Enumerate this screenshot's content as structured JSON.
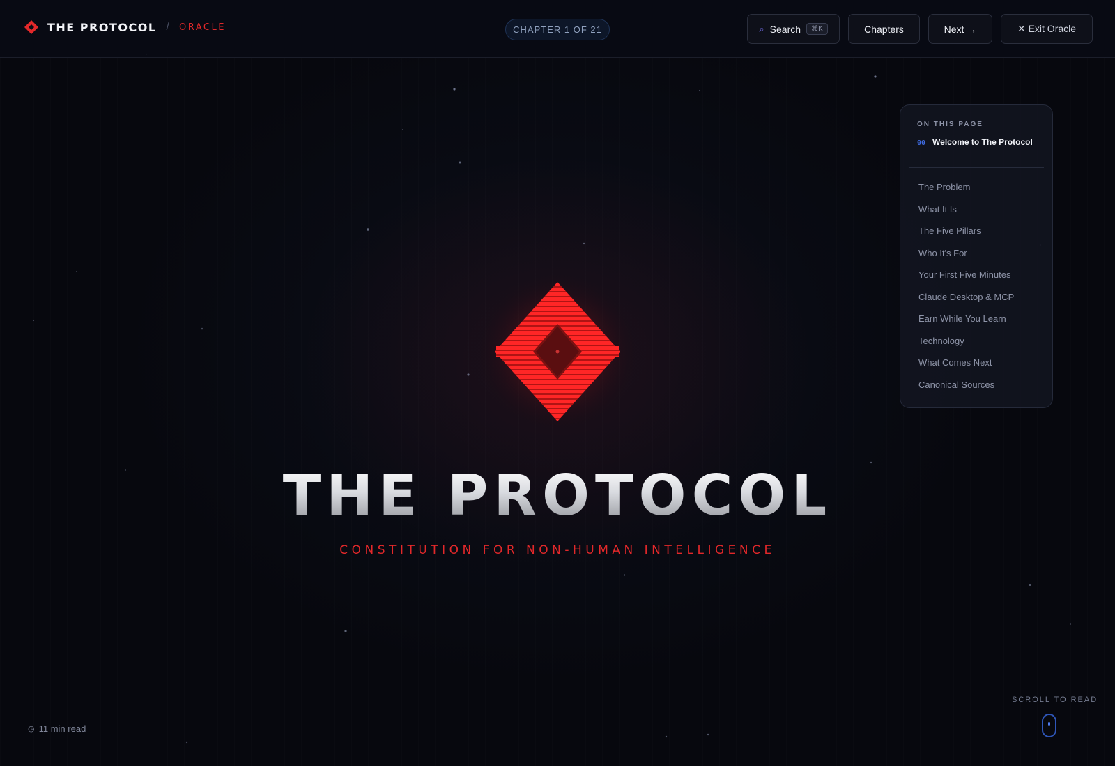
{
  "header": {
    "brand_title": "THE PROTOCOL",
    "brand_separator": "/",
    "brand_section": "ORACLE",
    "chapter_indicator": "CHAPTER 1 OF 21",
    "search_label": "Search",
    "search_shortcut": "⌘K",
    "chapters_label": "Chapters",
    "next_label": "Next →",
    "exit_label": "✕ Exit Oracle"
  },
  "hero": {
    "title": "THE PROTOCOL",
    "subtitle": "CONSTITUTION FOR NON-HUMAN INTELLIGENCE"
  },
  "toc": {
    "heading": "ON THIS PAGE",
    "current_number": "00",
    "current_label": "Welcome to The Protocol",
    "items": [
      "The Problem",
      "What It Is",
      "The Five Pillars",
      "Who It's For",
      "Your First Five Minutes",
      "Claude Desktop & MCP",
      "Earn While You Learn",
      "Technology",
      "What Comes Next",
      "Canonical Sources"
    ]
  },
  "footer": {
    "read_time": "11 min read",
    "scroll_label": "SCROLL TO READ"
  },
  "colors": {
    "accent_red": "#e3282a",
    "accent_blue": "#3f6be0",
    "background": "#07080e"
  },
  "icons": {
    "brand": "red-diamond-logo-icon",
    "search": "search-icon",
    "clock": "clock-icon",
    "scroll": "mouse-scroll-icon"
  }
}
